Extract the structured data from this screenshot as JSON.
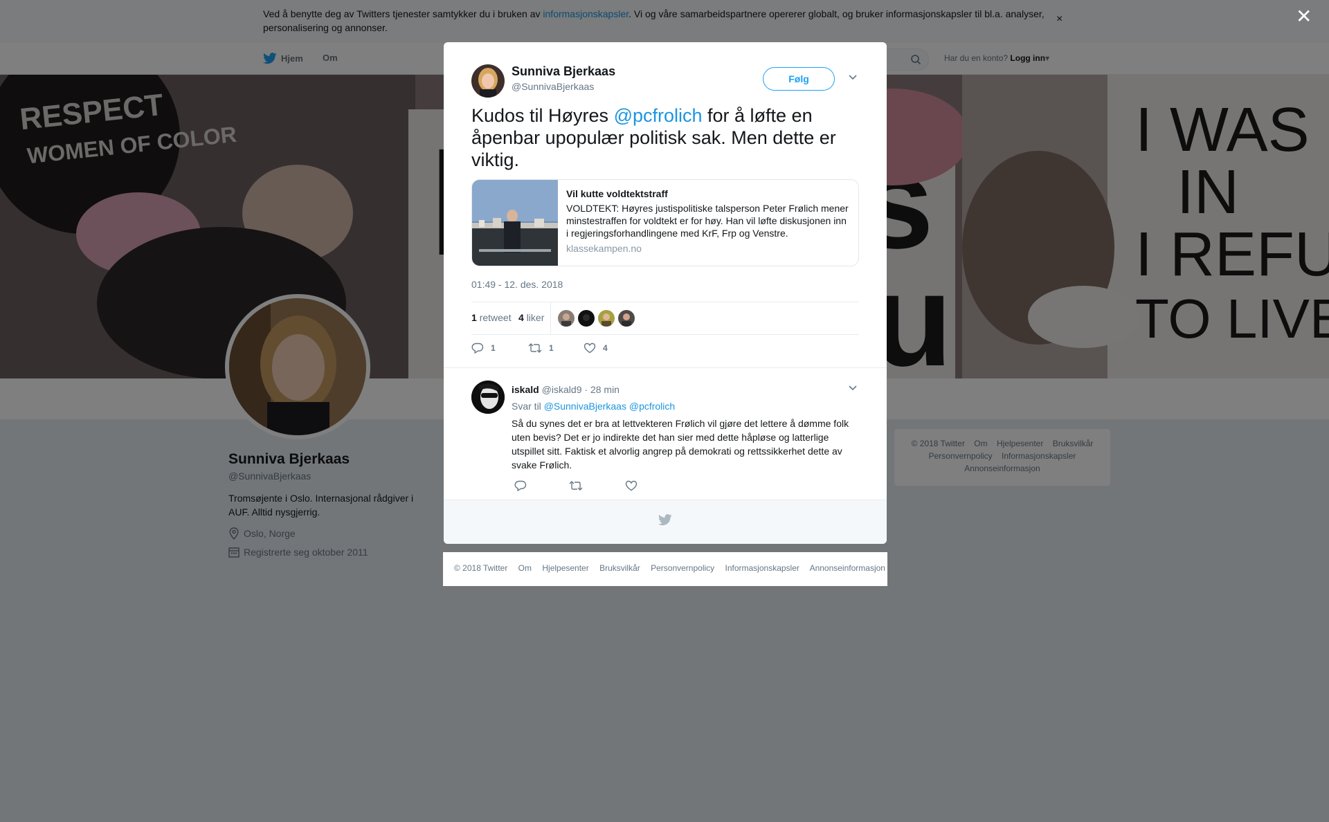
{
  "cookie_bar": {
    "text_before": "Ved å benytte deg av Twitters tjenester samtykker du i bruken av ",
    "link": "informasjonskapsler",
    "text_after": ". Vi og våre samarbeidspartnere opererer globalt, og bruker informasjonskapsler til bl.a. analyser, personalisering og annonser.",
    "close": "×"
  },
  "nav": {
    "home": "Hjem",
    "about": "Om",
    "account_question": "Har du en konto?",
    "login": "Logg inn",
    "login_caret": "▾"
  },
  "profile": {
    "name": "Sunniva Bjerkaas",
    "handle": "@SunnivaBjerkaas",
    "bio": "Tromsøjente i Oslo. Internasjonal rådgiver i AUF. Alltid nysgjerrig.",
    "location": "Oslo, Norge",
    "joined": "Registrerte seg oktober 2011"
  },
  "side_footer": {
    "links": [
      "© 2018 Twitter",
      "Om",
      "Hjelpesenter",
      "Bruksvilkår",
      "Personvernpolicy",
      "Informasjonskapsler",
      "Annonseinformasjon"
    ]
  },
  "overlay_close": "✕",
  "tweet": {
    "author_name": "Sunniva Bjerkaas",
    "author_handle": "@SunnivaBjerkaas",
    "follow_label": "Følg",
    "text_before": "Kudos til Høyres ",
    "mention": "@pcfrolich",
    "text_after": " for å løfte en åpenbar upopulær politisk sak. Men dette er viktig.",
    "card": {
      "title": "Vil kutte voldtektstraff",
      "description": "VOLDTEKT: Høyres justispolitiske talsperson Peter Frølich mener minstestraffen for voldtekt er for høy. Han vil løfte diskusjonen inn i regjeringsforhandlingene med KrF, Frp og Venstre.",
      "domain": "klassekampen.no"
    },
    "timestamp": "01:49 - 12. des. 2018",
    "retweets_count": "1",
    "retweets_label": "retweet",
    "likes_count": "4",
    "likes_label": "liker",
    "actions": {
      "replies": "1",
      "retweets": "1",
      "likes": "4"
    }
  },
  "reply": {
    "name": "iskald",
    "handle": "@iskald9",
    "time": "· 28 min",
    "reply_to_label": "Svar til ",
    "reply_to_mentions": "@SunnivaBjerkaas @pcfrolich",
    "text": "Så du synes det er bra at lettvekteren Frølich vil gjøre det lettere å dømme folk uten bevis? Det er jo indirekte det han sier med dette håpløse og latterlige utspillet sitt. Faktisk et alvorlig angrep på demokrati og rettssikkerhet dette av svake Frølich."
  },
  "bottom_footer": {
    "links": [
      "© 2018 Twitter",
      "Om",
      "Hjelpesenter",
      "Bruksvilkår",
      "Personvernpolicy",
      "Informasjonskapsler",
      "Annonseinformasjon"
    ]
  },
  "colors": {
    "brand_blue": "#1da1f2",
    "link_blue": "#1b95e0",
    "muted_text": "#657786"
  }
}
